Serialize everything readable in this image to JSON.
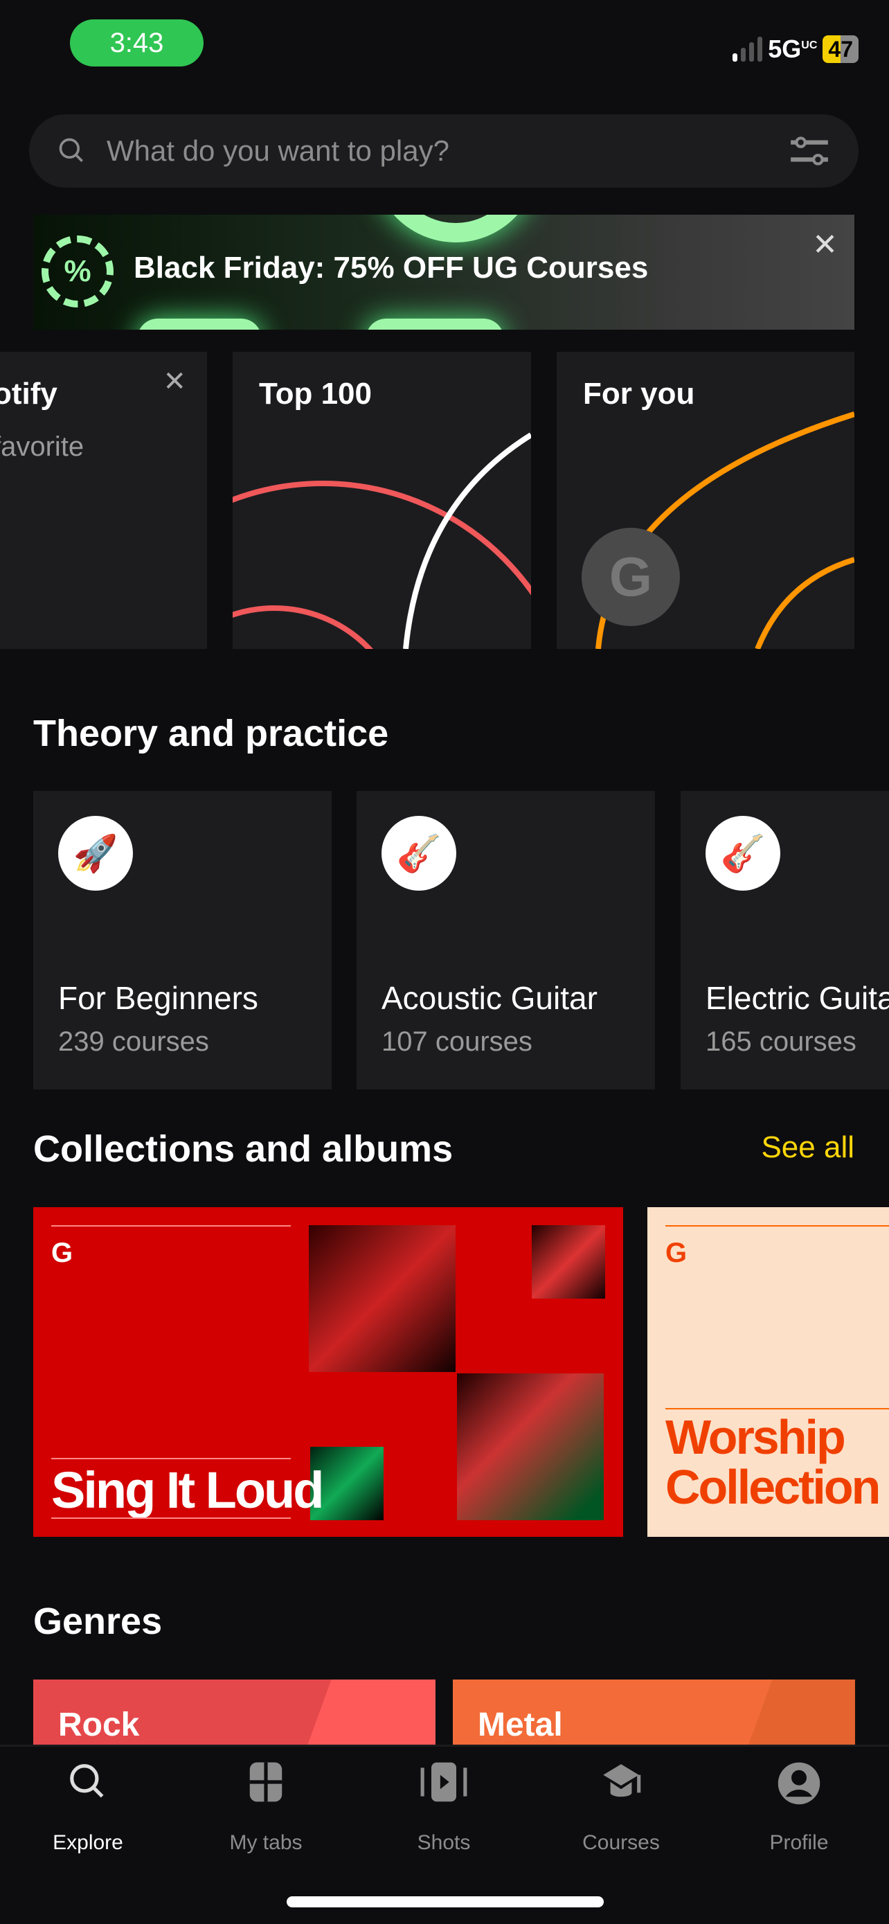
{
  "status_bar": {
    "time": "3:43",
    "network": "5G",
    "network_sup": "UC",
    "battery": "47"
  },
  "search": {
    "placeholder": "What do you want to play?"
  },
  "banner": {
    "text": "Black Friday: 75% OFF UG Courses",
    "badge": "%"
  },
  "featured": [
    {
      "title": "otify",
      "subtitle": "favorite"
    },
    {
      "title": "Top 100"
    },
    {
      "title": "For you"
    }
  ],
  "theory": {
    "title": "Theory and practice",
    "items": [
      {
        "name": "For Beginners",
        "count": "239 courses",
        "icon": "rocket-icon"
      },
      {
        "name": "Acoustic Guitar",
        "count": "107 courses",
        "icon": "acoustic-headstock-icon"
      },
      {
        "name": "Electric Guitar",
        "count": "165 courses",
        "icon": "electric-headstock-icon"
      }
    ]
  },
  "collections": {
    "title": "Collections and albums",
    "see_all": "See all",
    "items": [
      {
        "title": "Sing It Loud",
        "color": "#d20000"
      },
      {
        "title": "Worship Collection",
        "color": "#fde0c8"
      }
    ]
  },
  "genres": {
    "title": "Genres",
    "items": [
      {
        "name": "Rock",
        "color": "#e5484b"
      },
      {
        "name": "Metal",
        "color": "#f26b38"
      }
    ]
  },
  "nav": [
    {
      "label": "Explore",
      "active": true
    },
    {
      "label": "My tabs"
    },
    {
      "label": "Shots"
    },
    {
      "label": "Courses"
    },
    {
      "label": "Profile"
    }
  ],
  "colors": {
    "accent": "#ffd60a",
    "background": "#0d0d0f",
    "card": "#1c1c1f"
  }
}
